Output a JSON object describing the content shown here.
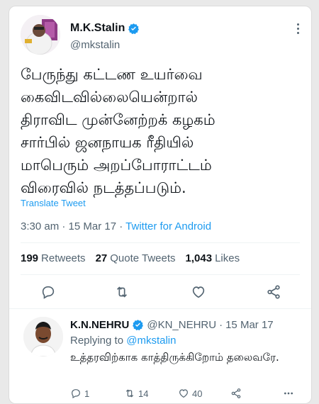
{
  "tweet": {
    "author_name": "M.K.Stalin",
    "author_handle": "@mkstalin",
    "text": "பேருந்து கட்டண உயர்வை\nகைவிடவில்லையென்றால்\nதிராவிட முன்னேற்றக் கழகம்\nசார்பில் ஜனநாயக ரீதியில்\nமாபெரும் அறப்போராட்டம்\nவிரைவில் நடத்தப்படும்.",
    "translate_label": "Translate Tweet",
    "time": "3:30 am",
    "date": "15 Mar 17",
    "source": "Twitter for Android",
    "separator": "·",
    "stats": {
      "retweets_count": "199",
      "retweets_label": "Retweets",
      "quotes_count": "27",
      "quotes_label": "Quote Tweets",
      "likes_count": "1,043",
      "likes_label": "Likes"
    }
  },
  "reply": {
    "author_name": "K.N.NEHRU",
    "author_handle": "@KN_NEHRU",
    "date": "15 Mar 17",
    "replying_to_label": "Replying to",
    "replying_to_handle": "@mkstalin",
    "text": "உத்தரவிற்காக காத்திருக்கிறோம் தலைவரே.",
    "reply_count": "1",
    "retweet_count": "14",
    "like_count": "40"
  },
  "colors": {
    "accent": "#1d9bf0",
    "secondary_text": "#536471",
    "primary_text": "#0f1419"
  },
  "icons": [
    "verified-badge-icon",
    "more-icon",
    "reply-icon",
    "retweet-icon",
    "like-icon",
    "share-icon"
  ]
}
